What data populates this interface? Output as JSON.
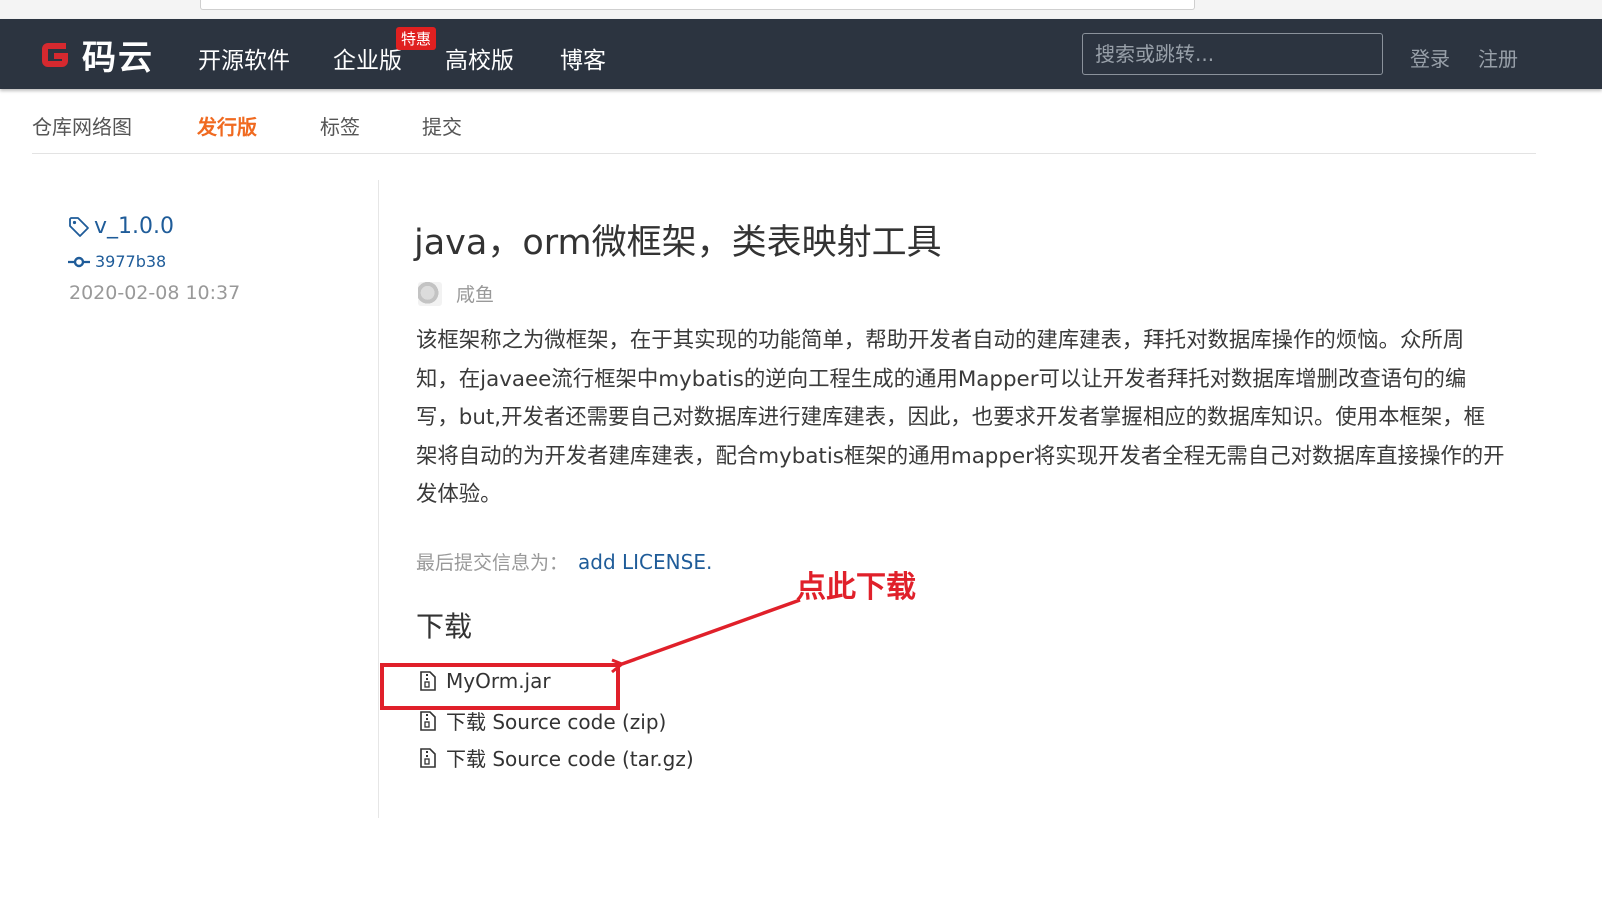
{
  "header": {
    "brand": "码云",
    "nav": [
      {
        "label": "开源软件"
      },
      {
        "label": "企业版"
      },
      {
        "label": "高校版"
      },
      {
        "label": "博客"
      }
    ],
    "enterprise_badge": "特惠",
    "search_placeholder": "搜索或跳转...",
    "login": "登录",
    "register": "注册"
  },
  "subnav": {
    "tabs": [
      {
        "label": "仓库网络图",
        "active": false
      },
      {
        "label": "发行版",
        "active": true
      },
      {
        "label": "标签",
        "active": false
      },
      {
        "label": "提交",
        "active": false
      }
    ]
  },
  "release": {
    "tag": "v_1.0.0",
    "commit": "3977b38",
    "date": "2020-02-08 10:37",
    "title": "java，orm微框架，类表映射工具",
    "author": "咸鱼",
    "description": "该框架称之为微框架，在于其实现的功能简单，帮助开发者自动的建库建表，拜托对数据库操作的烦恼。众所周知，在javaee流行框架中mybatis的逆向工程生成的通用Mapper可以让开发者拜托对数据库增删改查语句的编写，but,开发者还需要自己对数据库进行建库建表，因此，也要求开发者掌握相应的数据库知识。使用本框架，框架将自动的为开发者建库建表，配合mybatis框架的通用mapper将实现开发者全程无需自己对数据库直接操作的开发体验。",
    "last_commit_label": "最后提交信息为：",
    "last_commit_msg": "add LICENSE.",
    "downloads_heading": "下载",
    "downloads": [
      {
        "label": "MyOrm.jar"
      },
      {
        "label": "下载 Source code (zip)"
      },
      {
        "label": "下载 Source code (tar.gz)"
      }
    ]
  },
  "annotation": {
    "text": "点此下载",
    "color": "#e0202a"
  },
  "colors": {
    "nav_bg": "#2c3440",
    "active_tab": "#f06a20",
    "link": "#1f5c99",
    "badge": "#e02020"
  }
}
